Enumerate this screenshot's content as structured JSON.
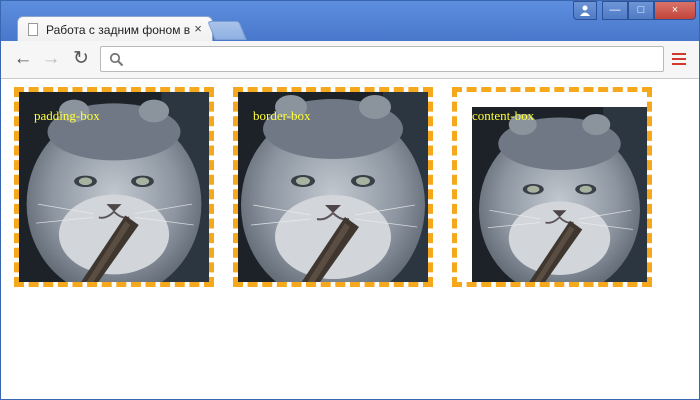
{
  "window": {
    "tab_title": "Работа с задним фоном в C",
    "tab_close": "×",
    "controls": {
      "minimize": "—",
      "maximize": "□",
      "close": "×"
    }
  },
  "toolbar": {
    "back": "←",
    "forward": "→",
    "reload": "↻",
    "url": ""
  },
  "demo": {
    "accent": "#f5a81c",
    "label_color": "#ffff3a",
    "boxes": [
      {
        "label": "padding-box"
      },
      {
        "label": "border-box"
      },
      {
        "label": "content-box"
      }
    ]
  },
  "icons": [
    "profile-icon",
    "search-icon",
    "menu-icon",
    "page-icon",
    "close-icon"
  ]
}
